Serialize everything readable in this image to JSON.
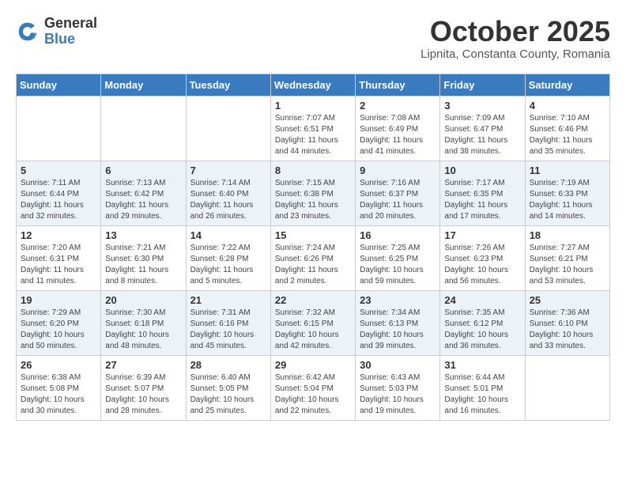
{
  "logo": {
    "general": "General",
    "blue": "Blue"
  },
  "title": "October 2025",
  "subtitle": "Lipnita, Constanta County, Romania",
  "weekdays": [
    "Sunday",
    "Monday",
    "Tuesday",
    "Wednesday",
    "Thursday",
    "Friday",
    "Saturday"
  ],
  "weeks": [
    [
      {
        "day": "",
        "info": ""
      },
      {
        "day": "",
        "info": ""
      },
      {
        "day": "",
        "info": ""
      },
      {
        "day": "1",
        "info": "Sunrise: 7:07 AM\nSunset: 6:51 PM\nDaylight: 11 hours\nand 44 minutes."
      },
      {
        "day": "2",
        "info": "Sunrise: 7:08 AM\nSunset: 6:49 PM\nDaylight: 11 hours\nand 41 minutes."
      },
      {
        "day": "3",
        "info": "Sunrise: 7:09 AM\nSunset: 6:47 PM\nDaylight: 11 hours\nand 38 minutes."
      },
      {
        "day": "4",
        "info": "Sunrise: 7:10 AM\nSunset: 6:46 PM\nDaylight: 11 hours\nand 35 minutes."
      }
    ],
    [
      {
        "day": "5",
        "info": "Sunrise: 7:11 AM\nSunset: 6:44 PM\nDaylight: 11 hours\nand 32 minutes."
      },
      {
        "day": "6",
        "info": "Sunrise: 7:13 AM\nSunset: 6:42 PM\nDaylight: 11 hours\nand 29 minutes."
      },
      {
        "day": "7",
        "info": "Sunrise: 7:14 AM\nSunset: 6:40 PM\nDaylight: 11 hours\nand 26 minutes."
      },
      {
        "day": "8",
        "info": "Sunrise: 7:15 AM\nSunset: 6:38 PM\nDaylight: 11 hours\nand 23 minutes."
      },
      {
        "day": "9",
        "info": "Sunrise: 7:16 AM\nSunset: 6:37 PM\nDaylight: 11 hours\nand 20 minutes."
      },
      {
        "day": "10",
        "info": "Sunrise: 7:17 AM\nSunset: 6:35 PM\nDaylight: 11 hours\nand 17 minutes."
      },
      {
        "day": "11",
        "info": "Sunrise: 7:19 AM\nSunset: 6:33 PM\nDaylight: 11 hours\nand 14 minutes."
      }
    ],
    [
      {
        "day": "12",
        "info": "Sunrise: 7:20 AM\nSunset: 6:31 PM\nDaylight: 11 hours\nand 11 minutes."
      },
      {
        "day": "13",
        "info": "Sunrise: 7:21 AM\nSunset: 6:30 PM\nDaylight: 11 hours\nand 8 minutes."
      },
      {
        "day": "14",
        "info": "Sunrise: 7:22 AM\nSunset: 6:28 PM\nDaylight: 11 hours\nand 5 minutes."
      },
      {
        "day": "15",
        "info": "Sunrise: 7:24 AM\nSunset: 6:26 PM\nDaylight: 11 hours\nand 2 minutes."
      },
      {
        "day": "16",
        "info": "Sunrise: 7:25 AM\nSunset: 6:25 PM\nDaylight: 10 hours\nand 59 minutes."
      },
      {
        "day": "17",
        "info": "Sunrise: 7:26 AM\nSunset: 6:23 PM\nDaylight: 10 hours\nand 56 minutes."
      },
      {
        "day": "18",
        "info": "Sunrise: 7:27 AM\nSunset: 6:21 PM\nDaylight: 10 hours\nand 53 minutes."
      }
    ],
    [
      {
        "day": "19",
        "info": "Sunrise: 7:29 AM\nSunset: 6:20 PM\nDaylight: 10 hours\nand 50 minutes."
      },
      {
        "day": "20",
        "info": "Sunrise: 7:30 AM\nSunset: 6:18 PM\nDaylight: 10 hours\nand 48 minutes."
      },
      {
        "day": "21",
        "info": "Sunrise: 7:31 AM\nSunset: 6:16 PM\nDaylight: 10 hours\nand 45 minutes."
      },
      {
        "day": "22",
        "info": "Sunrise: 7:32 AM\nSunset: 6:15 PM\nDaylight: 10 hours\nand 42 minutes."
      },
      {
        "day": "23",
        "info": "Sunrise: 7:34 AM\nSunset: 6:13 PM\nDaylight: 10 hours\nand 39 minutes."
      },
      {
        "day": "24",
        "info": "Sunrise: 7:35 AM\nSunset: 6:12 PM\nDaylight: 10 hours\nand 36 minutes."
      },
      {
        "day": "25",
        "info": "Sunrise: 7:36 AM\nSunset: 6:10 PM\nDaylight: 10 hours\nand 33 minutes."
      }
    ],
    [
      {
        "day": "26",
        "info": "Sunrise: 6:38 AM\nSunset: 5:08 PM\nDaylight: 10 hours\nand 30 minutes."
      },
      {
        "day": "27",
        "info": "Sunrise: 6:39 AM\nSunset: 5:07 PM\nDaylight: 10 hours\nand 28 minutes."
      },
      {
        "day": "28",
        "info": "Sunrise: 6:40 AM\nSunset: 5:05 PM\nDaylight: 10 hours\nand 25 minutes."
      },
      {
        "day": "29",
        "info": "Sunrise: 6:42 AM\nSunset: 5:04 PM\nDaylight: 10 hours\nand 22 minutes."
      },
      {
        "day": "30",
        "info": "Sunrise: 6:43 AM\nSunset: 5:03 PM\nDaylight: 10 hours\nand 19 minutes."
      },
      {
        "day": "31",
        "info": "Sunrise: 6:44 AM\nSunset: 5:01 PM\nDaylight: 10 hours\nand 16 minutes."
      },
      {
        "day": "",
        "info": ""
      }
    ]
  ]
}
